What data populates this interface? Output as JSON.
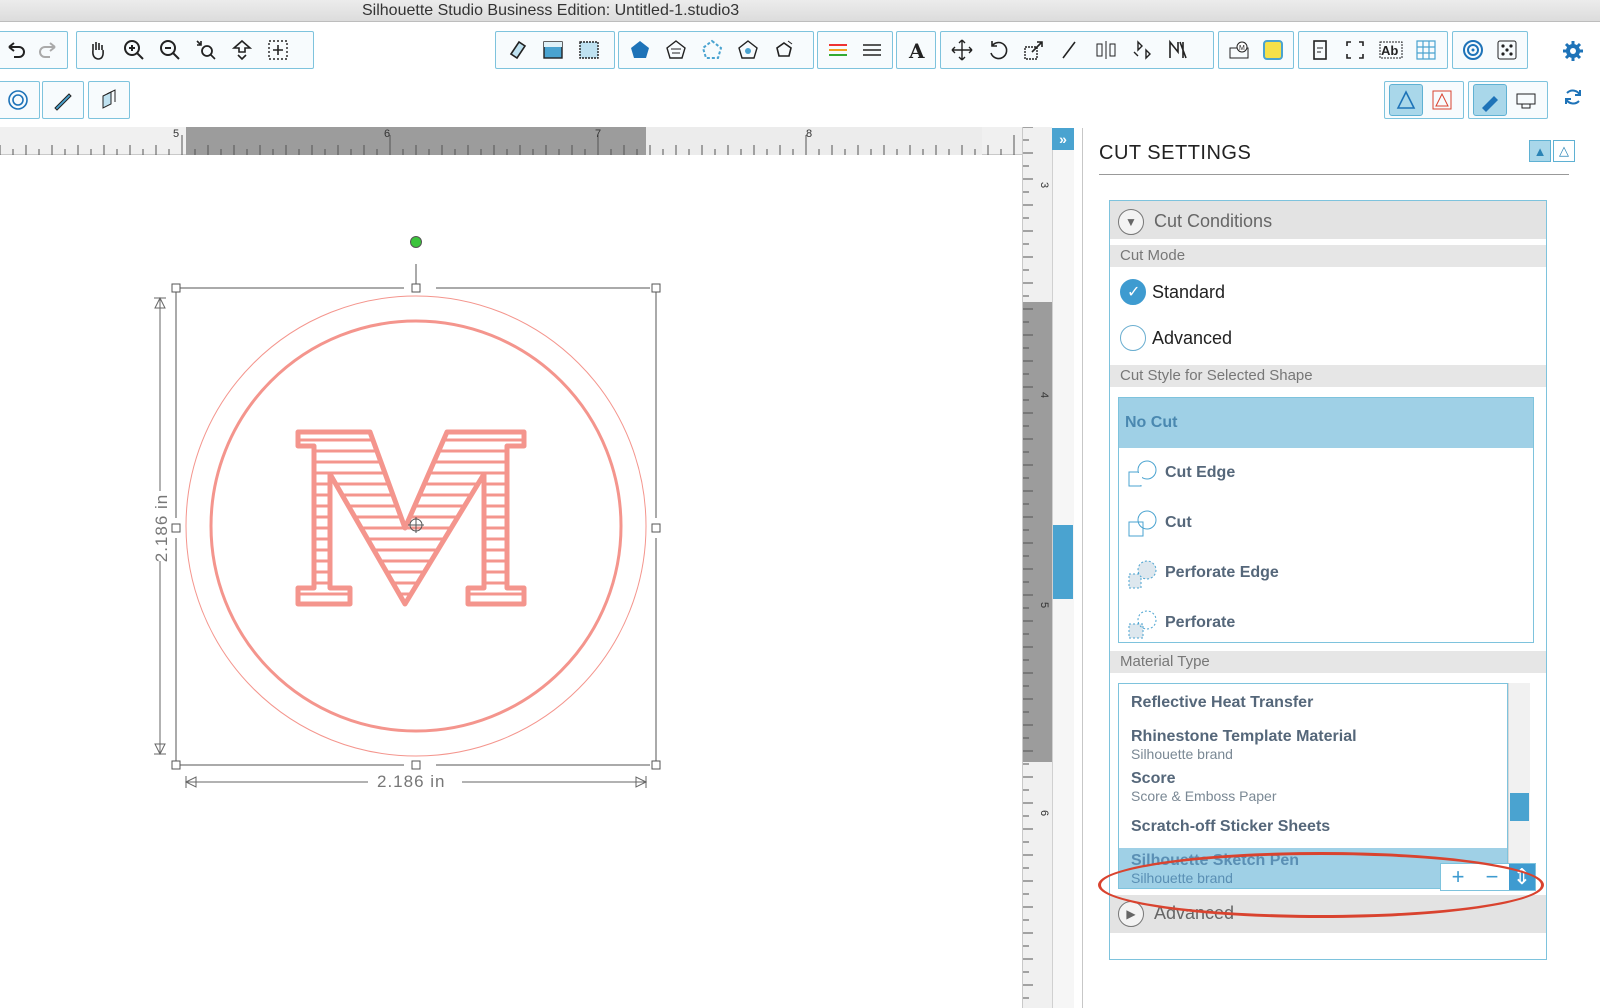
{
  "window": {
    "title": "Silhouette Studio Business Edition: Untitled-1.studio3"
  },
  "ruler": {
    "h_ticks": [
      "5",
      "6",
      "7",
      "8"
    ],
    "v_ticks": [
      "3",
      "4",
      "5",
      "6"
    ]
  },
  "design": {
    "letter": "M",
    "width_label": "2.186 in",
    "height_label": "2.186 in",
    "colors": {
      "shape": "#f4958d",
      "handle": "#555555",
      "rotate_handle": "#3cc43c"
    }
  },
  "toolbar": {
    "icons": [
      "undo-icon",
      "redo-icon",
      "pan-icon",
      "zoom-in-icon",
      "zoom-out-icon",
      "zoom-select-icon",
      "drag-zoom-icon",
      "fit-to-page-icon",
      "eraser-icon",
      "fill-panel-icon",
      "pattern-fill-icon",
      "pentagon-fill-icon",
      "line-style-icon",
      "line-color-icon",
      "point-edit-icon",
      "offset-icon",
      "line-panel-icon",
      "lines-icon",
      "text-icon",
      "transform-icon",
      "rotate-icon",
      "scale-icon",
      "shear-icon",
      "align-icon",
      "replicate-icon",
      "modify-icon",
      "library-icon",
      "store-icon",
      "page-setup-icon",
      "trace-icon",
      "text-style-icon",
      "grid-icon",
      "registration-icon",
      "dots-icon",
      "settings-icon"
    ]
  },
  "panel": {
    "title": "CUT SETTINGS",
    "cut_conditions": "Cut Conditions",
    "cut_mode_label": "Cut Mode",
    "modes": [
      {
        "label": "Standard",
        "selected": true
      },
      {
        "label": "Advanced",
        "selected": false
      }
    ],
    "cut_style_label": "Cut Style for Selected Shape",
    "cut_styles": [
      {
        "label": "No Cut",
        "selected": true
      },
      {
        "label": "Cut Edge",
        "selected": false
      },
      {
        "label": "Cut",
        "selected": false
      },
      {
        "label": "Perforate Edge",
        "selected": false
      },
      {
        "label": "Perforate",
        "selected": false
      }
    ],
    "material_label": "Material Type",
    "materials": [
      {
        "name": "Reflective Heat Transfer",
        "sub": ""
      },
      {
        "name": "Rhinestone Template Material",
        "sub": "Silhouette brand"
      },
      {
        "name": "Score",
        "sub": "Score & Emboss Paper"
      },
      {
        "name": "Scratch-off Sticker Sheets",
        "sub": ""
      },
      {
        "name": "Silhouette Sketch Pen",
        "sub": "Silhouette brand",
        "selected": true
      }
    ],
    "add_label": "+",
    "remove_label": "−",
    "advanced": "Advanced",
    "accent": "#3e9bd0",
    "annotation_color": "#d9432f"
  }
}
